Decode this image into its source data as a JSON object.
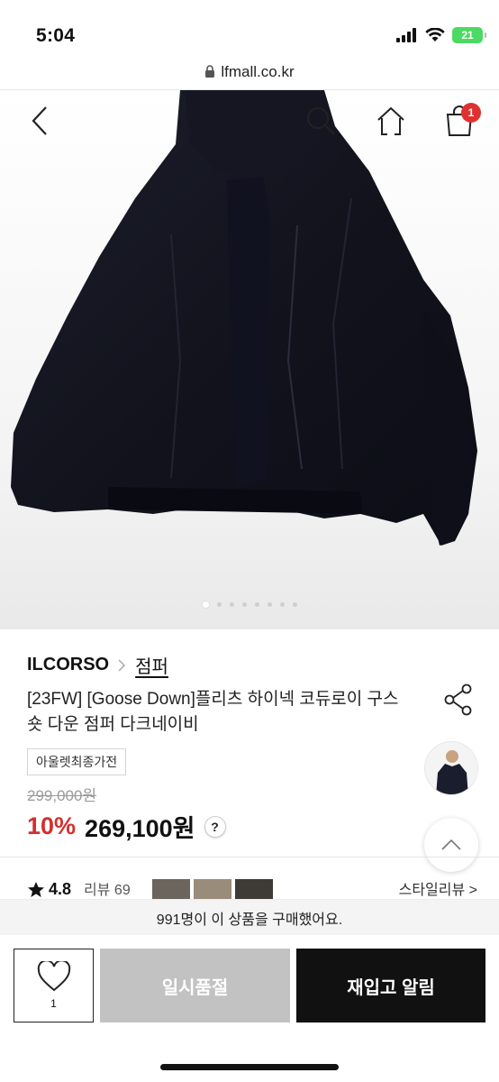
{
  "status": {
    "time": "5:04",
    "battery": "21"
  },
  "browser": {
    "url": "lfmall.co.kr"
  },
  "icons": {
    "back": "chevron-left-icon",
    "search": "search-icon",
    "home": "home-icon",
    "cart": "shopping-bag-icon",
    "share": "share-icon",
    "wishlist": "heart-icon",
    "scroll_up": "chevron-up-icon",
    "lock": "lock-icon"
  },
  "header": {
    "cart_count": "1"
  },
  "carousel": {
    "total": 8,
    "active_index": 0
  },
  "product": {
    "brand": "ILCORSO",
    "category": "점퍼",
    "title": "[23FW] [Goose Down]플리츠 하이넥 코듀로이 구스 숏 다운 점퍼 다크네이비",
    "tag": "아울렛최종가전",
    "original_price": "299,000원",
    "discount": "10%",
    "price": "269,100원",
    "price_help": "?"
  },
  "reviews": {
    "rating": "4.8",
    "count": "리뷰 69",
    "style_link": "스타일리뷰 >"
  },
  "purchased_notice": "991명이 이 상품을 구매했어요.",
  "actions": {
    "wish_count": "1",
    "sold_out_label": "일시품절",
    "restock_label": "재입고 알림"
  },
  "colors": {
    "discount": "#d32f2f",
    "badge": "#e03131",
    "sold_out_bg": "#c2c2c2",
    "restock_bg": "#111111",
    "battery": "#4cd964"
  }
}
